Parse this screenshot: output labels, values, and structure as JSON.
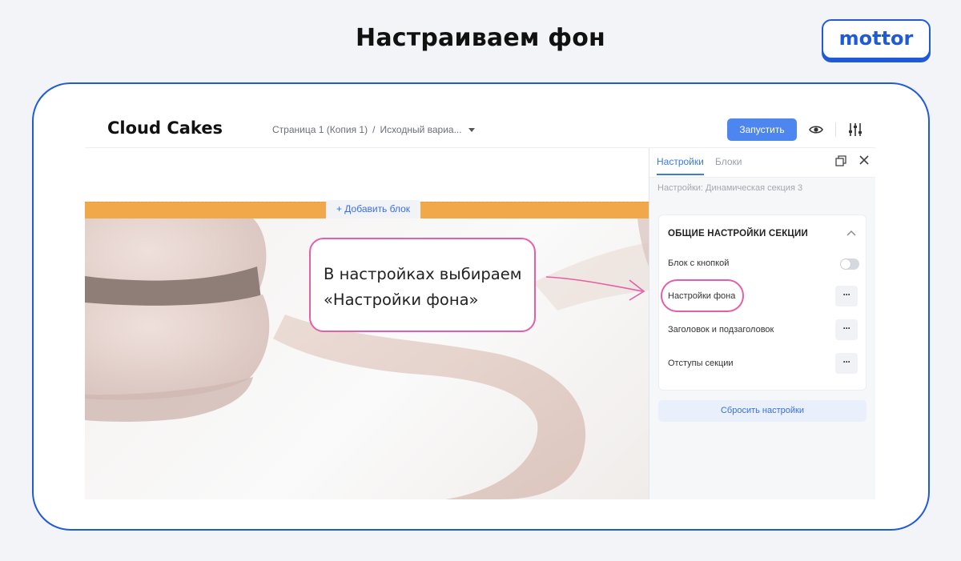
{
  "slide": {
    "title": "Настраиваем фон",
    "logo": "mottor"
  },
  "topbar": {
    "brand": "Cloud Cakes",
    "page": "Страница 1 (Копия 1)",
    "separator": "/",
    "variant": "Исходный вариа...",
    "run_label": "Запустить"
  },
  "canvas": {
    "add_block_label": "+ Добавить блок"
  },
  "callout": {
    "line1": "В настройках выбираем",
    "line2": "«Настройки фона»"
  },
  "panel": {
    "tabs": [
      "Настройки",
      "Блоки"
    ],
    "path": "Настройки: Динамическая секция 3",
    "section_title": "ОБЩИЕ НАСТРОЙКИ СЕКЦИИ",
    "rows": [
      "Блок с кнопкой",
      "Настройки фона",
      "Заголовок и подзаголовок",
      "Отступы секции"
    ],
    "more_label": "···",
    "reset_label": "Сбросить настройки"
  },
  "colors": {
    "accent": "#1f5bd8",
    "highlight": "#e35fa8",
    "orange": "#f0a84a",
    "button": "#4e86f0"
  }
}
